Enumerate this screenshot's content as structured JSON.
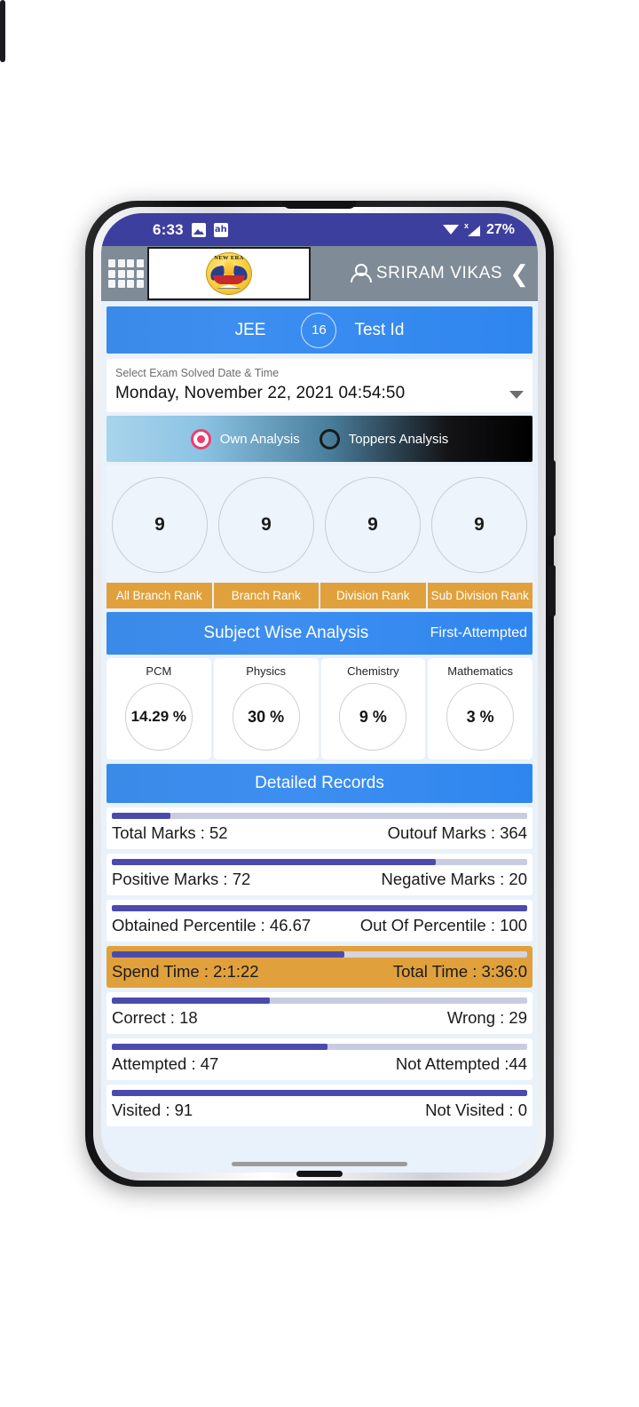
{
  "status_bar": {
    "time": "6:33",
    "battery": "27%",
    "icons": [
      "photo-icon",
      "hindi-app-icon",
      "wifi-icon",
      "signal-no-sim-icon"
    ]
  },
  "app_bar": {
    "menu_icon": "grid-menu-icon",
    "logo_text": "NEW ERA",
    "account_icon": "person-icon",
    "account_name": "SRIRAM VIKAS",
    "back_icon": "chevron-left-icon"
  },
  "exam_band": {
    "exam_name": "JEE",
    "test_id_value": "16",
    "test_id_label": "Test Id"
  },
  "date_picker": {
    "label": "Select Exam Solved Date & Time",
    "value": "Monday, November 22, 2021 04:54:50",
    "dropdown_icon": "chevron-down-icon"
  },
  "analysis_toggle": {
    "options": [
      {
        "label": "Own Analysis",
        "selected": true
      },
      {
        "label": "Toppers Analysis",
        "selected": false
      }
    ]
  },
  "ranks": {
    "items": [
      {
        "value": "9",
        "label": "All Branch Rank"
      },
      {
        "value": "9",
        "label": "Branch Rank"
      },
      {
        "value": "9",
        "label": "Division Rank"
      },
      {
        "value": "9",
        "label": "Sub Division Rank"
      }
    ]
  },
  "subject_wise": {
    "title": "Subject Wise Analysis",
    "tag": "First-Attempted",
    "subjects": [
      {
        "name": "PCM",
        "value": "14.29 %"
      },
      {
        "name": "Physics",
        "value": "30 %"
      },
      {
        "name": "Chemistry",
        "value": "9 %"
      },
      {
        "name": "Mathematics",
        "value": "3 %"
      }
    ]
  },
  "detailed_records": {
    "title": "Detailed Records",
    "rows": [
      {
        "left": "Total Marks : 52",
        "right": "Outouf Marks : 364",
        "progress": 14,
        "highlight": false
      },
      {
        "left": "Positive Marks : 72",
        "right": "Negative Marks : 20",
        "progress": 78,
        "highlight": false
      },
      {
        "left": "Obtained Percentile : 46.67",
        "right": "Out Of Percentile : 100",
        "progress": 100,
        "highlight": false
      },
      {
        "left": "Spend Time : 2:1:22",
        "right": "Total Time : 3:36:0",
        "progress": 56,
        "highlight": true
      },
      {
        "left": "Correct : 18",
        "right": "Wrong : 29",
        "progress": 38,
        "highlight": false
      },
      {
        "left": "Attempted : 47",
        "right": "Not Attempted :44",
        "progress": 52,
        "highlight": false
      },
      {
        "left": "Visited : 91",
        "right": "Not Visited : 0",
        "progress": 100,
        "highlight": false
      }
    ]
  },
  "colors": {
    "status_bar": "#3d3f9e",
    "app_bar": "#7f8b96",
    "accent_blue": "#3d8ef0",
    "accent_orange": "#e0a13c",
    "progress_fill": "#4b4bad",
    "radio_selected": "#ef3d6e"
  }
}
